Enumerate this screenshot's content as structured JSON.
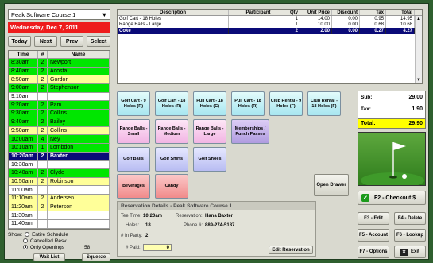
{
  "course_select": {
    "value": "Peak Software Course 1"
  },
  "date_bar": "Wednesday, Dec 7, 2011",
  "nav": {
    "today": "Today",
    "next": "Next",
    "prev": "Prev",
    "select": "Select"
  },
  "tee_sheet": {
    "headers": [
      "Time",
      "#",
      "Name"
    ],
    "rows": [
      {
        "time": "8:30am",
        "n": "2",
        "name": "Newport",
        "c": "g"
      },
      {
        "time": "8:40am",
        "n": "2",
        "name": "Acosta",
        "c": "g"
      },
      {
        "time": "8:50am",
        "n": "2",
        "name": "Gordon",
        "c": "y"
      },
      {
        "time": "9:00am",
        "n": "2",
        "name": "Stephenson",
        "c": "g"
      },
      {
        "time": "9:10am",
        "n": "",
        "name": "",
        "c": "w"
      },
      {
        "time": "9:20am",
        "n": "2",
        "name": "Pam",
        "c": "g"
      },
      {
        "time": "9:30am",
        "n": "2",
        "name": "Collins",
        "c": "g"
      },
      {
        "time": "9:40am",
        "n": "2",
        "name": "Bailey",
        "c": "g"
      },
      {
        "time": "9:50am",
        "n": "2",
        "name": "Collins",
        "c": "y"
      },
      {
        "time": "10:00am",
        "n": "4",
        "name": "Ney",
        "c": "g"
      },
      {
        "time": "10:10am",
        "n": "1",
        "name": "Lombdon",
        "c": "g"
      },
      {
        "time": "10:20am",
        "n": "2",
        "name": "Baxter",
        "c": "sel"
      },
      {
        "time": "10:30am",
        "n": "",
        "name": "",
        "c": "w"
      },
      {
        "time": "10:40am",
        "n": "2",
        "name": "Clyde",
        "c": "g"
      },
      {
        "time": "10:50am",
        "n": "2",
        "name": "Robinson",
        "c": "y"
      },
      {
        "time": "11:00am",
        "n": "",
        "name": "",
        "c": "w"
      },
      {
        "time": "11:10am",
        "n": "2",
        "name": "Andersen",
        "c": "y"
      },
      {
        "time": "11:20am",
        "n": "2",
        "name": "Peterson",
        "c": "y"
      },
      {
        "time": "11:30am",
        "n": "",
        "name": "",
        "c": "w"
      },
      {
        "time": "11:40am",
        "n": "",
        "name": "",
        "c": "w"
      }
    ]
  },
  "show_options": {
    "label": "Show:",
    "entire": "Entire Schedule",
    "cancelled": "Cancelled Resv",
    "only_openings": "Only Openings",
    "openings_count": "58"
  },
  "wait_list": "Wait List",
  "squeeze": "Squeeze",
  "items_grid": {
    "headers": [
      "Description",
      "Participant",
      "Qty",
      "Unit Price",
      "Discount",
      "Tax",
      "Total"
    ],
    "rows": [
      {
        "desc": "Golf Cart - 18 Holes",
        "part": "",
        "qty": "1",
        "price": "14.00",
        "disc": "0.00",
        "tax": "0.95",
        "total": "14.95",
        "sel": false
      },
      {
        "desc": "Range Balls - Large",
        "part": "",
        "qty": "1",
        "price": "10.00",
        "disc": "0.00",
        "tax": "0.68",
        "total": "10.68",
        "sel": false
      },
      {
        "desc": "Coke",
        "part": "",
        "qty": "2",
        "price": "2.00",
        "disc": "0.00",
        "tax": "0.27",
        "total": "4.27",
        "sel": true
      }
    ]
  },
  "item_buttons": {
    "cart9r": "Golf Cart - 9 Holes (R)",
    "cart18r": "Golf Cart - 18 Holes (R)",
    "pull18c": "Pull Cart - 18 Holes (C)",
    "pull18r": "Pull Cart - 18 Holes (R)",
    "club9f": "Club Rental - 9 Holes (F)",
    "club18f": "Club Rental - 18 Holes (F)",
    "range_small": "Range Balls - Small",
    "range_medium": "Range Balls - Medium",
    "range_large": "Range Balls - Large",
    "memberships": "Memberships / Punch Passes",
    "golf_balls": "Golf Balls",
    "golf_shirts": "Golf Shirts",
    "golf_shoes": "Golf Shoes",
    "beverages": "Beverages",
    "candy": "Candy",
    "open_drawer": "Open Drawer"
  },
  "totals": {
    "sub_label": "Sub:",
    "sub": "29.00",
    "tax_label": "Tax:",
    "tax": "1.90",
    "total_label": "Total:",
    "total": "29.90"
  },
  "reservation": {
    "title": "Reservation Details - Peak Software Course 1",
    "tee_time_label": "Tee Time:",
    "tee_time": "10:20am",
    "reservation_label": "Reservation:",
    "reservation": "Hana Baxter",
    "holes_label": "Holes:",
    "holes": "18",
    "phone_label": "Phone #:",
    "phone": "889-274-5187",
    "party_label": "# In Party:",
    "party": "2",
    "paid_label": "# Paid:",
    "paid": "0",
    "edit": "Edit Reservation"
  },
  "fkeys": {
    "checkout": "F2 - Checkout $",
    "edit": "F3 - Edit",
    "delete": "F4 - Delete",
    "account": "F5 - Account",
    "lookup": "F6 - Lookup",
    "options": "F7 - Options",
    "exit": "Exit"
  },
  "colors": {
    "tee_green": "#00e600",
    "tee_yellow": "#ffff99",
    "selected": "#0a0a78",
    "date_red": "#ee1c1c",
    "total_yellow": "#ffff00"
  }
}
